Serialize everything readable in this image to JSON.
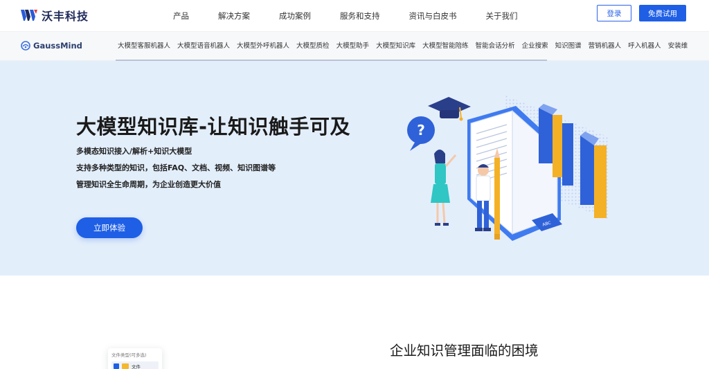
{
  "brand": {
    "name": "沃丰科技",
    "color": "#1f5fe6"
  },
  "nav": {
    "items": [
      "产品",
      "解决方案",
      "成功案例",
      "服务和支持",
      "资讯与白皮书",
      "关于我们"
    ],
    "login": "登录",
    "trial": "免费试用"
  },
  "subnav": {
    "logo": "GaussMind",
    "items": [
      "大模型客服机器人",
      "大模型语音机器人",
      "大模型外呼机器人",
      "大模型质检",
      "大模型助手",
      "大模型知识库",
      "大模型智能陪练",
      "智能会话分析",
      "企业搜索",
      "知识图谱",
      "营销机器人",
      "呼入机器人",
      "安装维"
    ],
    "active_index": 5
  },
  "hero": {
    "title": "大模型知识库-让知识触手可及",
    "lines": [
      "多模态知识接入/解析+知识大模型",
      "支持多种类型的知识，包括FAQ、文档、视频、知识图谱等",
      "管理知识全生命周期，为企业创造更大价值"
    ],
    "cta": "立即体验",
    "background": "#e3eefb",
    "illustration": {
      "bubble_text": "?",
      "card_text": "ABC"
    }
  },
  "section": {
    "title": "企业知识管理面临的困境",
    "panel": {
      "label": "文件类型(可多选)",
      "item": "文件"
    }
  },
  "icons": {
    "logo": "w-logo-icon",
    "gauss": "gaussmind-logo-icon",
    "checkbox": "checkbox-checked-icon",
    "folder": "folder-icon"
  }
}
